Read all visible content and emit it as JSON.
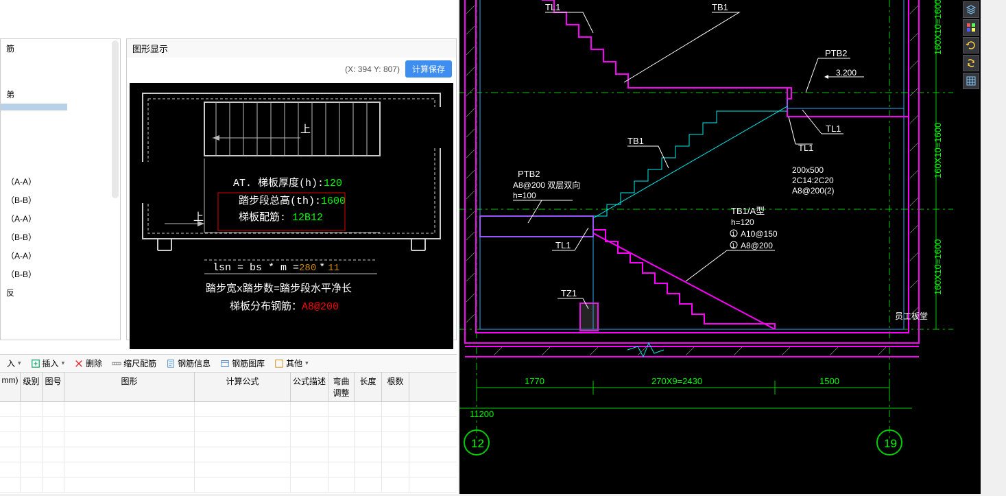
{
  "tree": {
    "items": [
      {
        "label": "筋"
      },
      {
        "label": "弟"
      },
      {
        "label": ""
      },
      {
        "label": "（A-A）"
      },
      {
        "label": "（B-B）"
      },
      {
        "label": "（A-A）"
      },
      {
        "label": "（B-B）"
      },
      {
        "label": "（A-A）"
      },
      {
        "label": "（B-B）"
      },
      {
        "label": "反"
      }
    ],
    "selected_index": 2
  },
  "graphic": {
    "title": "图形显示",
    "coords": "(X: 394 Y: 807)",
    "save_btn": "计算保存",
    "annotations": {
      "up1": "上",
      "up2": "上",
      "line1_label": "AT. 梯板厚度(h):",
      "line1_val": "120",
      "line2_label": "踏步段总高(th):",
      "line2_val": "1600",
      "line3_label": "梯板配筋: ",
      "line3_val": "12B12",
      "formula_label": "lsn = bs * m =",
      "formula_v1": "280",
      "formula_star": "*",
      "formula_v2": "11",
      "desc": "踏步宽x踏步数=踏步段水平净长",
      "rebar_label": "梯板分布钢筋：",
      "rebar_val": "A8@200"
    }
  },
  "toolbar": {
    "insert_top": "入",
    "insert": "插入",
    "delete": "删除",
    "ruler": "缩尺配筋",
    "rebar_info": "钢筋信息",
    "rebar_lib": "钢筋图库",
    "other": "其他"
  },
  "grid": {
    "headers": [
      "mm)",
      "级别",
      "图号",
      "图形",
      "计算公式",
      "公式描述",
      "弯曲调整",
      "长度",
      "根数"
    ],
    "widths": [
      30,
      32,
      32,
      190,
      140,
      55,
      38,
      40,
      40
    ]
  },
  "cad": {
    "labels": {
      "tl1_a": "TL1",
      "tb1_a": "TB1",
      "ptb2_a": "PTB2",
      "dim_3200": "3.200",
      "tl1_b": "TL1",
      "tl1_c": "TL1",
      "tb1_b": "TB1",
      "ptb2_b": "PTB2",
      "ptb2_spec1": "A8@200 双层双向",
      "ptb2_spec2": "h=100",
      "beam_spec1": "200x500",
      "beam_spec2": "2C14:2C20",
      "beam_spec3": "A8@200(2)",
      "tb1_type": "TB1/A型",
      "tb1_h": "h=120",
      "tb1_r1": "A10@150",
      "tb1_r2": "A8@200",
      "tl1_d": "TL1",
      "tz1": "TZ1",
      "room": "员工板堂",
      "dim_1770": "1770",
      "dim_270x9": "270X9=2430",
      "dim_1500": "1500",
      "dim_11200": "11200",
      "dim_160_a": "160X10=1600",
      "dim_160_b": "160X10=1600",
      "dim_160_c": "160X10=1600",
      "bubble_12": "12",
      "bubble_19": "19",
      "circ1": "1",
      "circ2": "1"
    }
  },
  "right_tools": [
    "layers",
    "palette",
    "restore",
    "refresh",
    "grid"
  ]
}
